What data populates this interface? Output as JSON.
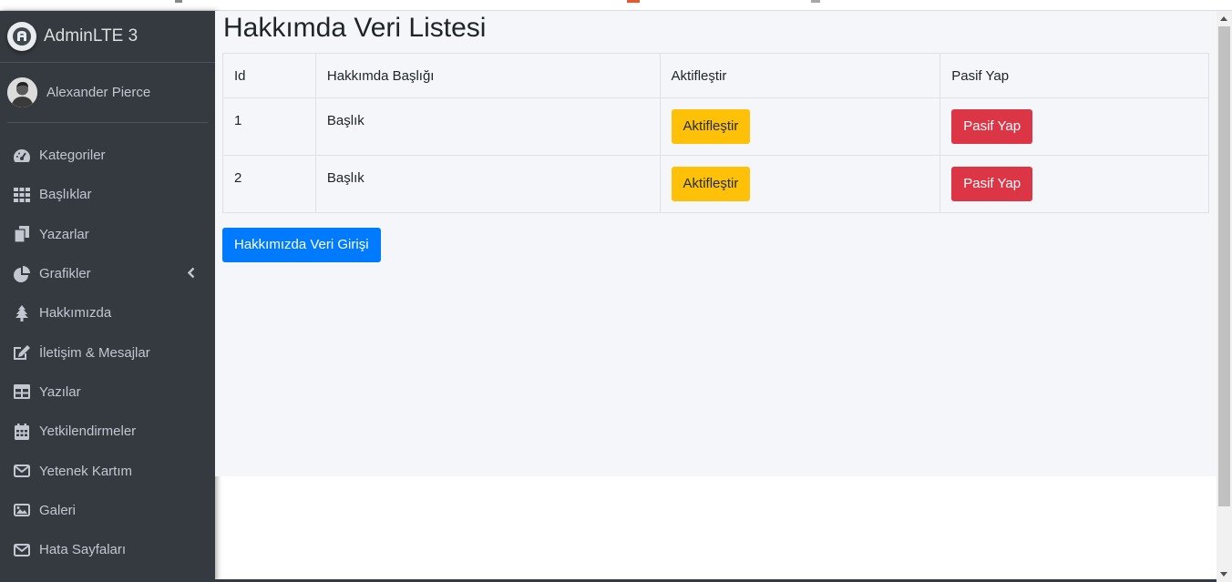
{
  "brand": {
    "text": "AdminLTE 3"
  },
  "user": {
    "name": "Alexander Pierce"
  },
  "sidebar": {
    "items": [
      {
        "label": "Kategoriler",
        "icon": "tachometer-icon"
      },
      {
        "label": "Başlıklar",
        "icon": "th-grid-icon"
      },
      {
        "label": "Yazarlar",
        "icon": "copy-icon"
      },
      {
        "label": "Grafikler",
        "icon": "pie-chart-icon"
      },
      {
        "label": "Hakkımızda",
        "icon": "tree-icon"
      },
      {
        "label": "İletişim & Mesajlar",
        "icon": "edit-icon"
      },
      {
        "label": "Yazılar",
        "icon": "table-icon"
      },
      {
        "label": "Yetkilendirmeler",
        "icon": "calendar-icon"
      },
      {
        "label": "Yetenek Kartım",
        "icon": "envelope-icon"
      },
      {
        "label": "Galeri",
        "icon": "image-icon"
      },
      {
        "label": "Hata Sayfaları",
        "icon": "envelope-icon"
      }
    ]
  },
  "page": {
    "title": "Hakkımda Veri Listesi"
  },
  "table": {
    "headers": [
      "Id",
      "Hakkımda Başlığı",
      "Aktifleştir",
      "Pasif Yap"
    ],
    "rows": [
      {
        "id": "1",
        "title": "Başlık",
        "activate": "Aktifleştir",
        "deactivate": "Pasif Yap"
      },
      {
        "id": "2",
        "title": "Başlık",
        "activate": "Aktifleştir",
        "deactivate": "Pasif Yap"
      }
    ]
  },
  "actions": {
    "add_label": "Hakkımızda Veri Girişi"
  },
  "colors": {
    "sidebar_bg": "#343a40",
    "content_bg": "#f4f6f9",
    "warning": "#ffc107",
    "danger": "#dc3545",
    "primary": "#007bff"
  }
}
